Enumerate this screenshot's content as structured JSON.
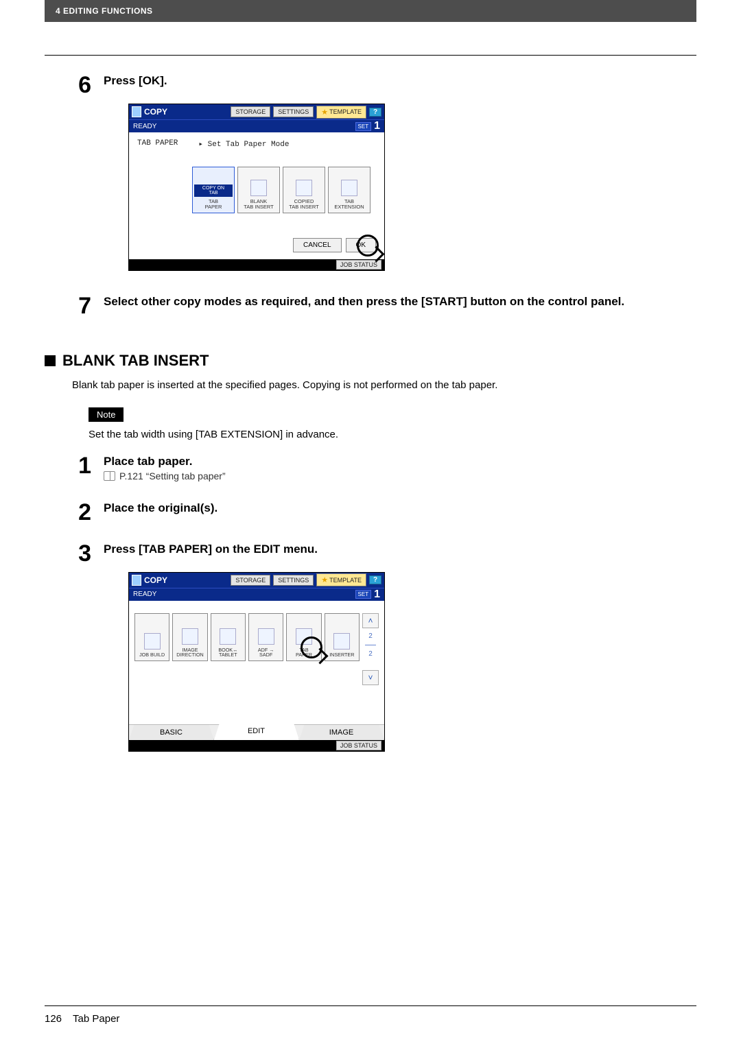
{
  "header": {
    "breadcrumb": "4 EDITING FUNCTIONS"
  },
  "step6": {
    "num": "6",
    "title": "Press [OK].",
    "shot": {
      "title": "COPY",
      "buttons": {
        "storage": "STORAGE",
        "settings": "SETTINGS",
        "template": "TEMPLATE",
        "help": "?"
      },
      "status_left": "READY",
      "status_right_set": "SET",
      "status_right_num": "1",
      "panel_label": "TAB PAPER",
      "panel_hint": "▸ Set Tab Paper Mode",
      "options": {
        "copy_on_tab_top": "COPY ON\nTAB",
        "copy_on_tab_bottom": "TAB\nPAPER",
        "blank": "BLANK\nTAB INSERT",
        "copied": "COPIED\nTAB INSERT",
        "tab_ext": "TAB\nEXTENSION"
      },
      "cancel": "CANCEL",
      "ok": "OK",
      "job_status": "JOB STATUS"
    }
  },
  "step7": {
    "num": "7",
    "title": "Select other copy modes as required, and then press the [START] button on the control panel."
  },
  "section": {
    "title": "BLANK TAB INSERT",
    "desc": "Blank tab paper is inserted at the specified pages. Copying is not performed on the tab paper.",
    "note_label": "Note",
    "note_text": "Set the tab width using [TAB EXTENSION] in advance."
  },
  "substeps": {
    "s1": {
      "num": "1",
      "title": "Place tab paper.",
      "ref": "P.121 “Setting tab paper”"
    },
    "s2": {
      "num": "2",
      "title": "Place the original(s)."
    },
    "s3": {
      "num": "3",
      "title": "Press [TAB PAPER] on the EDIT menu."
    }
  },
  "shot2": {
    "title": "COPY",
    "buttons": {
      "storage": "STORAGE",
      "settings": "SETTINGS",
      "template": "TEMPLATE",
      "help": "?"
    },
    "status_left": "READY",
    "status_right_set": "SET",
    "status_right_num": "1",
    "options": {
      "job_build": "JOB BUILD",
      "image_dir": "IMAGE\nDIRECTION",
      "book_tablet": "BOOK↔\nTABLET",
      "adf_sadf": "ADF →\nSADF",
      "tab_paper": "TAB\nPAPER",
      "inserter": "INSERTER"
    },
    "page_top": "2",
    "page_bot": "2",
    "tabs": {
      "basic": "BASIC",
      "edit": "EDIT",
      "image": "IMAGE"
    },
    "job_status": "JOB STATUS"
  },
  "footer": {
    "page": "126",
    "title": "Tab Paper"
  }
}
